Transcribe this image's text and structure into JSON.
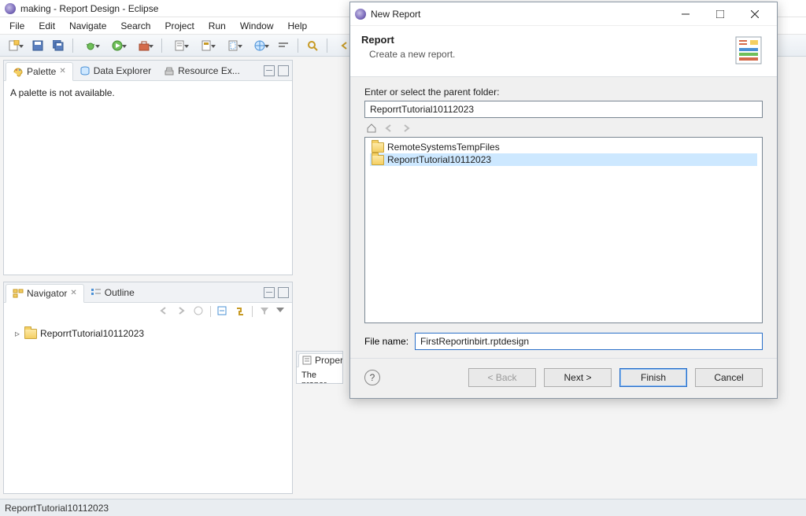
{
  "window": {
    "title": "making - Report Design - Eclipse"
  },
  "menu": {
    "file": "File",
    "edit": "Edit",
    "navigate": "Navigate",
    "search": "Search",
    "project": "Project",
    "run": "Run",
    "window": "Window",
    "help": "Help"
  },
  "palette_pane": {
    "tabs": {
      "palette": "Palette",
      "data_explorer": "Data Explorer",
      "resource_explorer": "Resource Ex..."
    },
    "empty_msg": "A palette is not available."
  },
  "navigator_pane": {
    "tabs": {
      "navigator": "Navigator",
      "outline": "Outline"
    },
    "tree": {
      "project": "ReporrtTutorial10112023"
    }
  },
  "properties_pane": {
    "tab": "Proper",
    "body": "The proper"
  },
  "statusbar": {
    "text": "ReporrtTutorial10112023"
  },
  "dialog": {
    "title": "New Report",
    "banner_heading": "Report",
    "banner_sub": "Create a new report.",
    "parent_label": "Enter or select the parent folder:",
    "parent_value": "ReporrtTutorial10112023",
    "tree": {
      "item1": "RemoteSystemsTempFiles",
      "item2": "ReporrtTutorial10112023"
    },
    "filename_label": "File name:",
    "filename_value": "FirstReportinbirt.rptdesign",
    "buttons": {
      "back": "< Back",
      "next": "Next >",
      "finish": "Finish",
      "cancel": "Cancel"
    }
  }
}
